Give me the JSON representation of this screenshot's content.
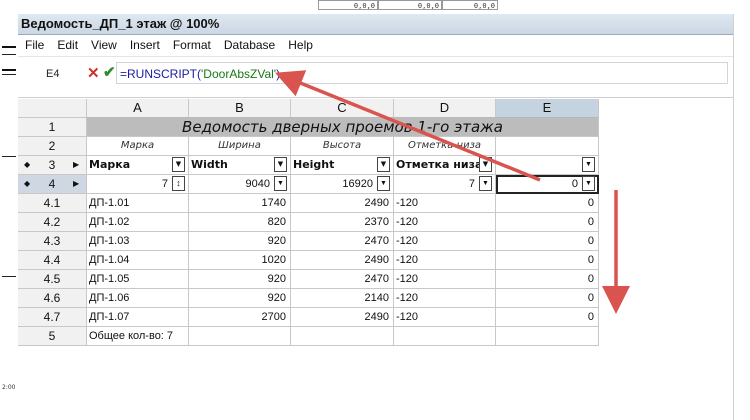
{
  "window": {
    "title": "Ведомость_ДП_1 этаж @ 100%"
  },
  "menu": [
    "File",
    "Edit",
    "View",
    "Insert",
    "Format",
    "Database",
    "Help"
  ],
  "formula_bar": {
    "cell_ref": "E4",
    "func": "=RUNSCRIPT(",
    "arg": "'DoorAbsZVal'",
    "close": ")"
  },
  "columns": [
    "A",
    "B",
    "C",
    "D",
    "E"
  ],
  "rows": {
    "r1": {
      "label": "1",
      "title": "Ведомость дверных проемов 1-го этажа"
    },
    "r2": {
      "label": "2",
      "a": "Марка",
      "b": "Ширина",
      "c": "Высота",
      "d": "Отметка низа"
    },
    "r3": {
      "label": "3",
      "a": "Марка",
      "b": "Width",
      "c": "Height",
      "d": "Отметка низа"
    },
    "r4": {
      "label": "4",
      "a": "7",
      "b": "9040",
      "c": "16920",
      "d": "7",
      "e": "0"
    },
    "data": [
      {
        "label": "4.1",
        "a": "ДП-1.01",
        "b": "1740",
        "c": "2490",
        "d": "-120",
        "e": "0"
      },
      {
        "label": "4.2",
        "a": "ДП-1.02",
        "b": "820",
        "c": "2370",
        "d": "-120",
        "e": "0"
      },
      {
        "label": "4.3",
        "a": "ДП-1.03",
        "b": "920",
        "c": "2470",
        "d": "-120",
        "e": "0"
      },
      {
        "label": "4.4",
        "a": "ДП-1.04",
        "b": "1020",
        "c": "2490",
        "d": "-120",
        "e": "0"
      },
      {
        "label": "4.5",
        "a": "ДП-1.05",
        "b": "920",
        "c": "2470",
        "d": "-120",
        "e": "0"
      },
      {
        "label": "4.6",
        "a": "ДП-1.06",
        "b": "920",
        "c": "2140",
        "d": "-120",
        "e": "0"
      },
      {
        "label": "4.7",
        "a": "ДП-1.07",
        "b": "2700",
        "c": "2490",
        "d": "-120",
        "e": "0"
      }
    ],
    "r5": {
      "label": "5",
      "a": "Общее кол-во: 7"
    }
  },
  "background": {
    "top_values": [
      "0,0,0",
      "0,0,0",
      "0,0,0"
    ],
    "left_tick": "2:00"
  },
  "colors": {
    "title_bg": "#bcbcbc",
    "arrow": "#d9534f",
    "selected": "#c5d2e0"
  }
}
